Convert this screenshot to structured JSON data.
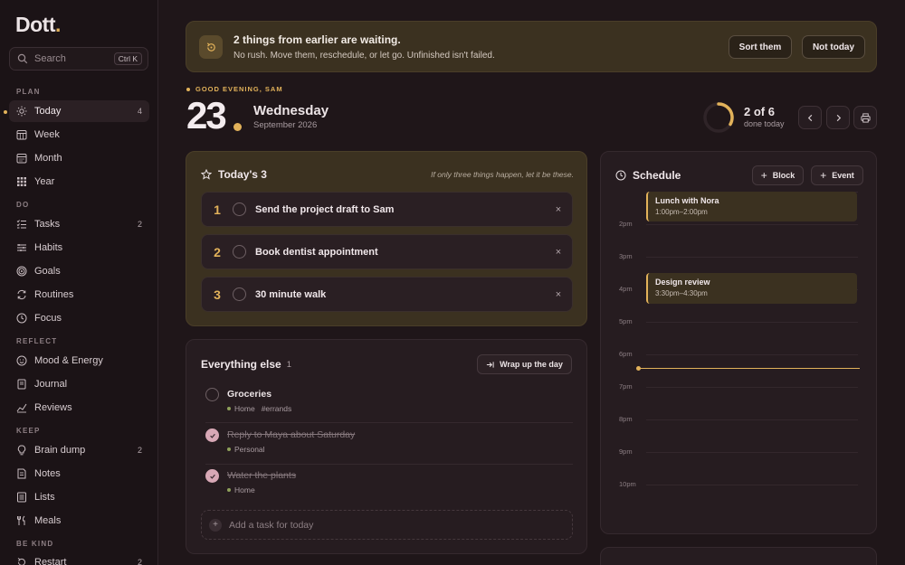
{
  "app": {
    "name": "Dott"
  },
  "search": {
    "placeholder": "Search",
    "shortcut": "Ctrl K"
  },
  "sidebar": {
    "sections": [
      {
        "label": "PLAN",
        "items": [
          {
            "label": "Today",
            "count": "4",
            "active": true,
            "icon": "sun-icon"
          },
          {
            "label": "Week",
            "count": "",
            "icon": "calendar-week-icon"
          },
          {
            "label": "Month",
            "count": "",
            "icon": "calendar-month-icon"
          },
          {
            "label": "Year",
            "count": "",
            "icon": "grid-year-icon"
          }
        ]
      },
      {
        "label": "DO",
        "items": [
          {
            "label": "Tasks",
            "count": "2",
            "icon": "checklist-icon"
          },
          {
            "label": "Habits",
            "count": "",
            "icon": "habits-icon"
          },
          {
            "label": "Goals",
            "count": "",
            "icon": "target-icon"
          },
          {
            "label": "Routines",
            "count": "",
            "icon": "repeat-icon"
          },
          {
            "label": "Focus",
            "count": "",
            "icon": "clock-icon"
          }
        ]
      },
      {
        "label": "REFLECT",
        "items": [
          {
            "label": "Mood & Energy",
            "count": "",
            "icon": "smile-icon"
          },
          {
            "label": "Journal",
            "count": "",
            "icon": "book-icon"
          },
          {
            "label": "Reviews",
            "count": "",
            "icon": "chart-icon"
          }
        ]
      },
      {
        "label": "KEEP",
        "items": [
          {
            "label": "Brain dump",
            "count": "2",
            "icon": "lightbulb-icon"
          },
          {
            "label": "Notes",
            "count": "",
            "icon": "note-icon"
          },
          {
            "label": "Lists",
            "count": "",
            "icon": "list-icon"
          },
          {
            "label": "Meals",
            "count": "",
            "icon": "utensils-icon"
          }
        ]
      },
      {
        "label": "BE KIND",
        "items": [
          {
            "label": "Restart",
            "count": "2",
            "icon": "restart-icon"
          }
        ]
      }
    ]
  },
  "banner": {
    "title": "2 things from earlier are waiting.",
    "subtitle": "No rush. Move them, reschedule, or let go. Unfinished isn't failed.",
    "sort_label": "Sort them",
    "dismiss_label": "Not today"
  },
  "header": {
    "greeting": "GOOD EVENING, SAM",
    "day_number": "23",
    "weekday": "Wednesday",
    "month_year": "September 2026",
    "progress_text": "2 of 6",
    "progress_sub": "done today",
    "progress_fraction": 0.333
  },
  "today3": {
    "title": "Today's 3",
    "hint": "If only three things happen, let it be these.",
    "items": [
      {
        "num": "1",
        "label": "Send the project draft to Sam"
      },
      {
        "num": "2",
        "label": "Book dentist appointment"
      },
      {
        "num": "3",
        "label": "30 minute walk"
      }
    ],
    "remove_glyph": "×"
  },
  "everything": {
    "title": "Everything else",
    "count": "1",
    "wrap_label": "Wrap up the day",
    "tasks": [
      {
        "name": "Groceries",
        "done": false,
        "area": "Home",
        "tag": "#errands"
      },
      {
        "name": "Reply to Maya about Saturday",
        "done": true,
        "area": "Personal",
        "tag": ""
      },
      {
        "name": "Water the plants",
        "done": true,
        "area": "Home",
        "tag": ""
      }
    ],
    "add_placeholder": "Add a task for today"
  },
  "schedule": {
    "title": "Schedule",
    "block_label": "Block",
    "event_label": "Event",
    "hours": [
      "2pm",
      "3pm",
      "4pm",
      "5pm",
      "6pm",
      "7pm",
      "8pm",
      "9pm",
      "10pm"
    ],
    "events": [
      {
        "name": "Lunch with Nora",
        "time": "1:00pm–2:00pm"
      },
      {
        "name": "Design review",
        "time": "3:30pm–4:30pm"
      }
    ]
  },
  "colors": {
    "accent": "#e2b25a",
    "background": "#1f1619",
    "card": "#261c20",
    "highlight_card": "#3b3120"
  }
}
